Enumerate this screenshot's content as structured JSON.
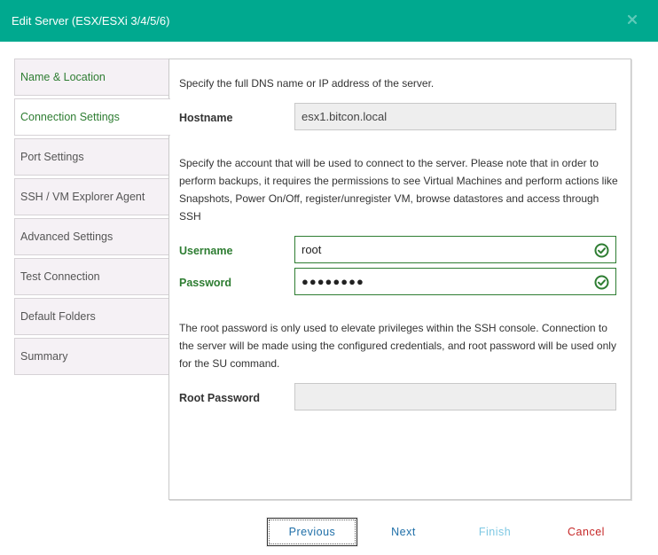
{
  "dialog": {
    "title": "Edit Server (ESX/ESXi 3/4/5/6)",
    "close_icon": "close-icon"
  },
  "sidebar": {
    "items": [
      {
        "label": "Name & Location",
        "state": "completed"
      },
      {
        "label": "Connection Settings",
        "state": "active"
      },
      {
        "label": "Port Settings",
        "state": "default"
      },
      {
        "label": "SSH / VM Explorer Agent",
        "state": "default"
      },
      {
        "label": "Advanced Settings",
        "state": "default"
      },
      {
        "label": "Test Connection",
        "state": "default"
      },
      {
        "label": "Default Folders",
        "state": "default"
      },
      {
        "label": "Summary",
        "state": "default"
      }
    ]
  },
  "form": {
    "dns_instruction": "Specify the full DNS name or IP address of the server.",
    "hostname_label": "Hostname",
    "hostname_value": "esx1.bitcon.local",
    "account_instruction": "Specify the account that will be used to connect to the server. Please note that in order to perform backups, it requires the permissions to see Virtual Machines and perform actions like Snapshots, Power On/Off, register/unregister VM, browse datastores and access through SSH",
    "username_label": "Username",
    "username_value": "root",
    "password_label": "Password",
    "password_value": "●●●●●●●●",
    "root_instruction": "The root password is only used to elevate privileges within the SSH console. Connection to the server will be made using the configured credentials, and root password will be used only for the SU command.",
    "root_password_label": "Root Password",
    "root_password_value": "",
    "valid_icon": "check-circle-icon"
  },
  "footer": {
    "previous_label": "Previous",
    "next_label": "Next",
    "finish_label": "Finish",
    "cancel_label": "Cancel"
  },
  "colors": {
    "accent": "#00a98f",
    "valid": "#2e7d32",
    "link": "#1f6fa8",
    "disabled": "#7ec8e3",
    "danger": "#c62828"
  }
}
